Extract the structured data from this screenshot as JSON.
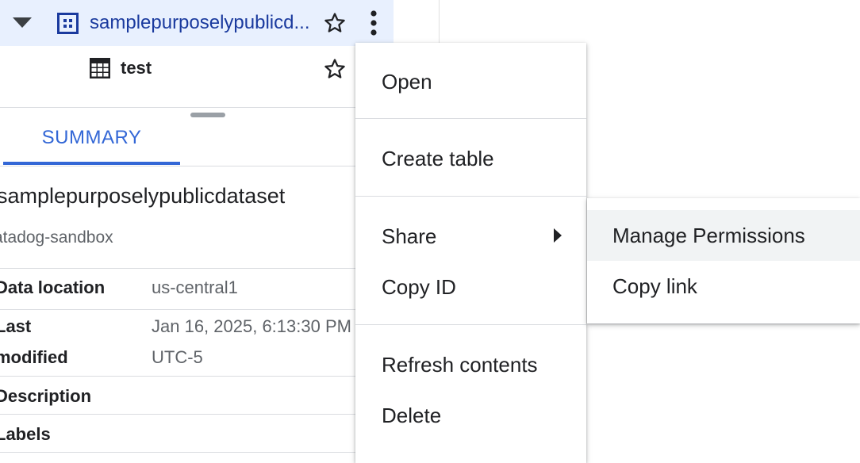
{
  "explorer": {
    "dataset_name": "samplepurposelypublicd...",
    "table_name": "test"
  },
  "tabs": [
    {
      "label": "SUMMARY",
      "active": true
    }
  ],
  "details": {
    "title": "samplepurposelypublicdataset",
    "project": "atadog-sandbox",
    "rows": [
      {
        "label": "Data location",
        "value": "us-central1"
      },
      {
        "label_line1": "Last",
        "label_line2": "modified",
        "value_line1": "Jan 16, 2025, 6:13:30 PM",
        "value_line2": "UTC-5"
      },
      {
        "label": "Description",
        "value": ""
      },
      {
        "label": "Labels",
        "value": ""
      }
    ]
  },
  "context_menu": {
    "items": [
      {
        "label": "Open"
      },
      {
        "label": "Create table"
      },
      {
        "label": "Share",
        "has_submenu": true
      },
      {
        "label": "Copy ID"
      },
      {
        "label": "Refresh contents"
      },
      {
        "label": "Delete"
      }
    ]
  },
  "share_submenu": {
    "items": [
      {
        "label": "Manage Permissions",
        "highlighted": true
      },
      {
        "label": "Copy link"
      }
    ]
  },
  "colors": {
    "selected_row_bg": "#e8f0fe",
    "link_blue": "#1a3a9e",
    "tab_blue": "#3367d6",
    "hover_bg": "#f1f3f4"
  },
  "icons": {
    "caret": "caret-down-icon",
    "dataset": "dataset-icon",
    "table": "table-icon",
    "star": "star-outline-icon",
    "more": "more-vert-icon",
    "submenu": "submenu-arrow-icon"
  }
}
